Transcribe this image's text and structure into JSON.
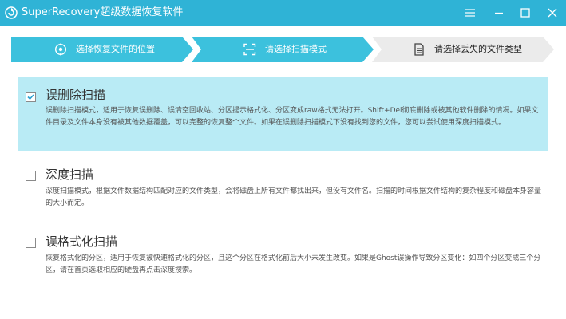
{
  "window": {
    "title": "SuperRecovery超级数据恢复软件",
    "controls": [
      "menu-icon",
      "minimize-icon",
      "maximize-icon",
      "close-icon"
    ],
    "titlebar_color": "#2fb3d6"
  },
  "steps": [
    {
      "label": "选择恢复文件的位置",
      "icon": "location-icon",
      "state": "done",
      "color": "#3cc1dd"
    },
    {
      "label": "请选择扫描模式",
      "icon": "scan-icon",
      "state": "active",
      "color": "#3cc1dd"
    },
    {
      "label": "请选择丢失的文件类型",
      "icon": "file-icon",
      "state": "pending",
      "color": "#ebebeb"
    }
  ],
  "options": [
    {
      "title": "误删除扫描",
      "checked": true,
      "description": "误删除扫描模式，适用于恢复误删除、误清空回收站、分区提示格式化、分区变成raw格式无法打开。Shift+Del彻底删除或被其他软件删除的情况。如果文件目录及文件本身没有被其他数据覆盖，可以完整的恢复整个文件。如果在误删除扫描模式下没有找到您的文件，您可以尝试使用深度扫描模式。"
    },
    {
      "title": "深度扫描",
      "checked": false,
      "description": "深度扫描模式，根据文件数据结构匹配对应的文件类型，会将磁盘上所有文件都找出来，但没有文件名。扫描的时间根据文件结构的复杂程度和磁盘本身容量的大小而定。"
    },
    {
      "title": "误格式化扫描",
      "checked": false,
      "description": "恢复格式化的分区，适用于恢复被快速格式化的分区，且这个分区在格式化前后大小未发生改变。如果是Ghost误操作导致分区变化：如四个分区变成三个分区，请在首页选取相应的硬盘再点击深度搜索。"
    }
  ],
  "colors": {
    "accent": "#2fb3d6",
    "selected_option_bg": "#b9ebf5",
    "check_mark": "#2a9fd0"
  }
}
